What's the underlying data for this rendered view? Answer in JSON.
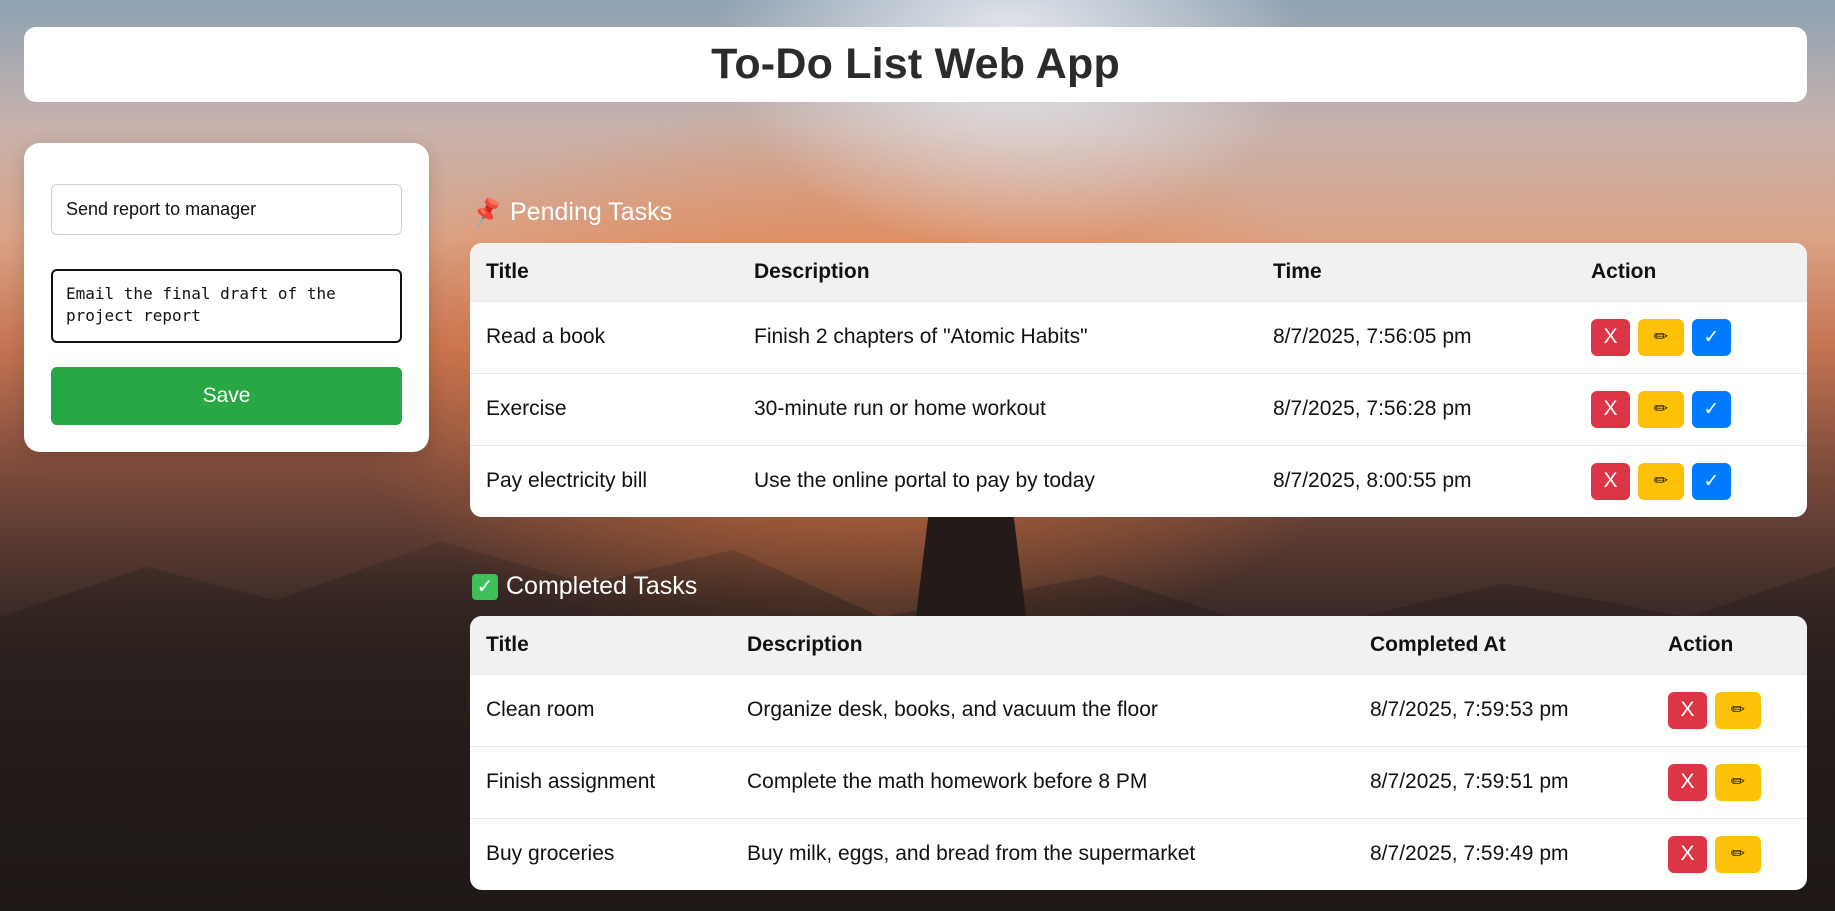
{
  "app": {
    "title": "To-Do List Web App"
  },
  "form": {
    "title_value": "Send report to manager",
    "description_value": "Email the final draft of the project report",
    "save_label": "Save"
  },
  "pending": {
    "heading": "Pending Tasks",
    "icon": "pushpin-icon",
    "columns": [
      "Title",
      "Description",
      "Time",
      "Action"
    ],
    "rows": [
      {
        "title": "Read a book",
        "description": "Finish 2 chapters of \"Atomic Habits\"",
        "time": "8/7/2025, 7:56:05 pm"
      },
      {
        "title": "Exercise",
        "description": "30-minute run or home workout",
        "time": "8/7/2025, 7:56:28 pm"
      },
      {
        "title": "Pay electricity bill",
        "description": "Use the online portal to pay by today",
        "time": "8/7/2025, 8:00:55 pm"
      }
    ]
  },
  "completed": {
    "heading": "Completed Tasks",
    "icon": "check-box-icon",
    "columns": [
      "Title",
      "Description",
      "Completed At",
      "Action"
    ],
    "rows": [
      {
        "title": "Clean room",
        "description": "Organize desk, books, and vacuum the floor",
        "time": "8/7/2025, 7:59:53 pm"
      },
      {
        "title": "Finish assignment",
        "description": "Complete the math homework before 8 PM",
        "time": "8/7/2025, 7:59:51 pm"
      },
      {
        "title": "Buy groceries",
        "description": "Buy milk, eggs, and bread from the supermarket",
        "time": "8/7/2025, 7:59:49 pm"
      }
    ]
  },
  "buttons": {
    "delete": "X",
    "edit": "✏",
    "done": "✓"
  },
  "colors": {
    "save": "#28a745",
    "delete": "#dc3545",
    "edit": "#ffc107",
    "done": "#007bff"
  }
}
